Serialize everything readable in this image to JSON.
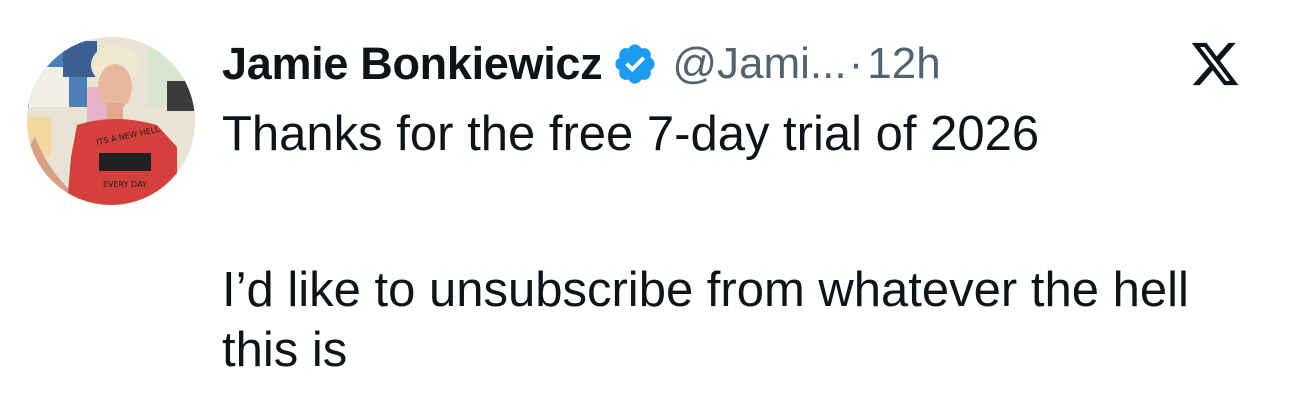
{
  "tweet": {
    "author": {
      "display_name": "Jamie Bonkiewicz",
      "handle": "@Jami...",
      "verified": true,
      "avatar": "profile-photo"
    },
    "separator": "·",
    "time": "12h",
    "platform_icon": "x-logo-icon",
    "text_line_1": "Thanks for the free 7-day trial of 2026",
    "text_line_2": "I’d like to unsubscribe from whatever the hell this is"
  },
  "colors": {
    "text_primary": "#0f1419",
    "text_secondary": "#536471",
    "verified_blue": "#1d9bf0",
    "background": "#ffffff"
  }
}
